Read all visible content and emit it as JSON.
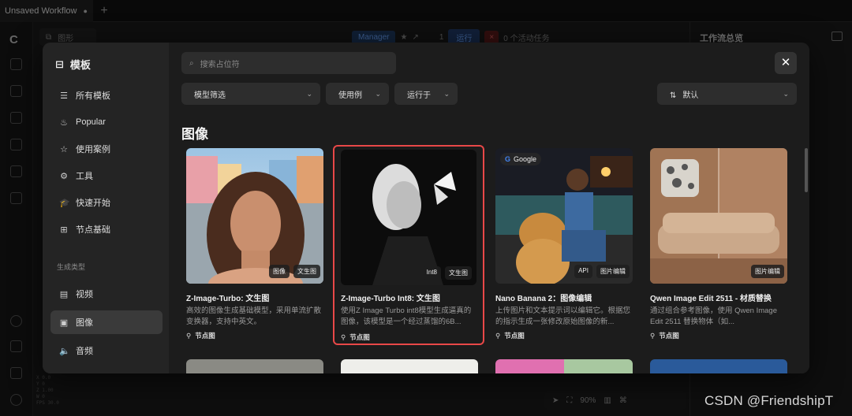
{
  "tabbar": {
    "tab_title": "Unsaved Workflow",
    "dirty_marker": "●",
    "add_label": "+"
  },
  "toolbar": {
    "graph_label": "图形",
    "manager_label": "Manager",
    "run_count": "1",
    "run_label": "运行",
    "stop_label": "×",
    "active_tasks": "0 个活动任务"
  },
  "right_panel": {
    "title": "工作流总览"
  },
  "canvas": {
    "zoom": "90%",
    "coords": [
      "X 0.0",
      "Y 0",
      "Z 1.00",
      "W 0",
      "FPS 30.0"
    ]
  },
  "watermark": "CSDN @FriendshipT",
  "modal": {
    "sidebar": {
      "title": "模板",
      "items": [
        {
          "icon": "list-icon",
          "glyph": "☰",
          "label": "所有模板"
        },
        {
          "icon": "flame-icon",
          "glyph": "♨",
          "label": "Popular"
        },
        {
          "icon": "star-icon",
          "glyph": "☆",
          "label": "使用案例"
        },
        {
          "icon": "gear-icon",
          "glyph": "⚙",
          "label": "工具"
        },
        {
          "icon": "graduation-cap-icon",
          "glyph": "🎓",
          "label": "快速开始"
        },
        {
          "icon": "blocks-icon",
          "glyph": "⊞",
          "label": "节点基础"
        }
      ],
      "section_label": "生成类型",
      "types": [
        {
          "icon": "film-icon",
          "glyph": "▤",
          "label": "视频"
        },
        {
          "icon": "image-icon",
          "glyph": "▣",
          "label": "图像",
          "active": true
        },
        {
          "icon": "speaker-icon",
          "glyph": "🔈",
          "label": "音频"
        }
      ]
    },
    "search": {
      "placeholder": "搜索占位符"
    },
    "filters": {
      "model_filter": "模型筛选",
      "use_case": "使用例",
      "runs_on": "运行于",
      "sort": "默认"
    },
    "section_title": "图像",
    "cards": [
      {
        "title": "Z-Image-Turbo: 文生图",
        "desc": "高效的图像生成基础模型，采用单流扩散变换器，支持中英文。",
        "tags": [
          "图像",
          "文生图"
        ],
        "meta": "节点图",
        "selected": false
      },
      {
        "title": "Z-Image-Turbo Int8: 文生图",
        "desc": "使用Z Image Turbo int8模型生成逼真的图像，该模型是一个经过蒸馏的6B...",
        "tags": [
          "Int8",
          "文生图"
        ],
        "meta": "节点图",
        "selected": true
      },
      {
        "title": "Nano Banana 2：图像编辑",
        "desc": "上传图片和文本提示词以编辑它。根据您的指示生成一张修改原始图像的新...",
        "tags": [
          "API",
          "图片编辑"
        ],
        "meta": "节点图",
        "selected": false,
        "badge": "Google"
      },
      {
        "title": "Qwen Image Edit 2511 - 材质替换",
        "desc": "通过组合参考图像，使用 Qwen Image Edit 2511 替换物体（如...",
        "tags": [
          "图片编辑"
        ],
        "meta": "节点图",
        "selected": false
      }
    ]
  }
}
